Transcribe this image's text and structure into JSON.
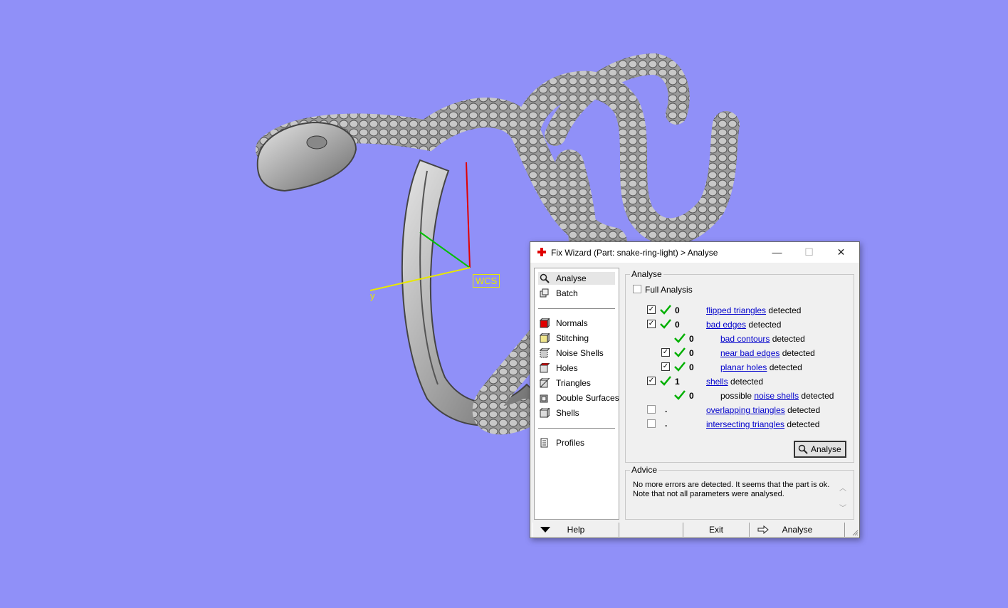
{
  "viewport": {
    "wcs_label": "WCS",
    "y_axis_label": "y",
    "colors": {
      "background": "#9090f8",
      "axis_y": "#e8e800",
      "axis_z": "#e00000",
      "axis_x": "#00c000"
    }
  },
  "dialog": {
    "title": "Fix Wizard (Part: snake-ring-light) > Analyse",
    "title_icon": "red-cross-icon",
    "nav_top": [
      {
        "label": "Analyse",
        "icon": "magnifier-icon",
        "selected": true
      },
      {
        "label": "Batch",
        "icon": "batch-icon"
      }
    ],
    "nav_fix": [
      {
        "label": "Normals",
        "icon": "normals-icon"
      },
      {
        "label": "Stitching",
        "icon": "stitching-icon"
      },
      {
        "label": "Noise Shells",
        "icon": "noise-shells-icon"
      },
      {
        "label": "Holes",
        "icon": "holes-icon"
      },
      {
        "label": "Triangles",
        "icon": "triangles-icon"
      },
      {
        "label": "Double Surfaces",
        "icon": "double-surfaces-icon"
      },
      {
        "label": "Shells",
        "icon": "shells-icon"
      }
    ],
    "nav_bottom": [
      {
        "label": "Profiles",
        "icon": "profiles-icon"
      }
    ],
    "analyse": {
      "group_title": "Analyse",
      "full_analysis_label": "Full Analysis",
      "detected": "detected",
      "possible": "possible",
      "rows": {
        "flipped": {
          "count": "0",
          "link": "flipped triangles"
        },
        "bad_edges": {
          "count": "0",
          "link": "bad edges"
        },
        "bad_contours": {
          "count": "0",
          "link": "bad contours"
        },
        "near_bad_edges": {
          "count": "0",
          "link": "near bad edges"
        },
        "planar_holes": {
          "count": "0",
          "link": "planar holes"
        },
        "shells": {
          "count": "1",
          "link": "shells"
        },
        "noise_shells": {
          "count": "0",
          "link": "noise shells"
        },
        "overlapping": {
          "count": ".",
          "link": "overlapping triangles"
        },
        "intersecting": {
          "count": ".",
          "link": "intersecting triangles"
        }
      },
      "button_label": "Analyse"
    },
    "advice": {
      "group_title": "Advice",
      "text": "No more errors are detected. It seems that the part is ok. Note that not all parameters were analysed."
    },
    "bottom": {
      "help": "Help",
      "exit": "Exit",
      "analyse": "Analyse"
    }
  }
}
